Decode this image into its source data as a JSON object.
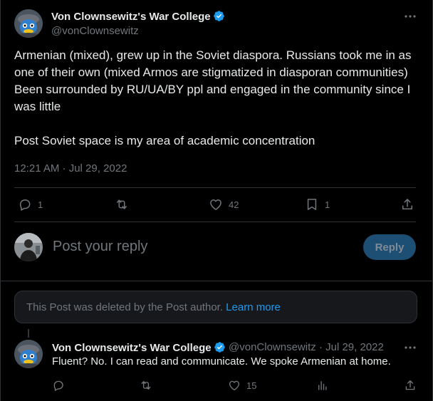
{
  "main_post": {
    "author_name": "Von Clownsewitz's War College",
    "handle": "@vonClownsewitz",
    "paragraph_1": "Armenian (mixed), grew up in the Soviet diaspora. Russians took me in as one of their own (mixed Armos are stigmatized in diasporan communities) Been surrounded by RU/UA/BY ppl and engaged in the community since I was little",
    "paragraph_2": "Post Soviet space is my area of academic concentration",
    "timestamp": "12:21 AM · Jul 29, 2022",
    "stats": {
      "replies": "1",
      "likes": "42",
      "bookmarks": "1"
    }
  },
  "composer": {
    "placeholder": "Post your reply",
    "button_label": "Reply"
  },
  "deleted_notice": {
    "text": "This Post was deleted by the Post author.",
    "link_label": "Learn more"
  },
  "reply_post": {
    "author_name": "Von Clownsewitz's War College",
    "handle": "@vonClownsewitz",
    "date": "· Jul 29, 2022",
    "text": "Fluent? No. I can read and communicate. We spoke Armenian at home.",
    "stats": {
      "likes": "15"
    }
  },
  "icons": {
    "verified": "verified-badge-icon",
    "more": "more-horizontal-icon",
    "reply": "reply-bubble-icon",
    "repost": "repost-icon",
    "like": "heart-icon",
    "bookmark": "bookmark-icon",
    "share": "share-upload-icon",
    "views": "views-bar-chart-icon"
  },
  "colors": {
    "background": "#000000",
    "text": "#e7e9ea",
    "muted": "#71767b",
    "accent": "#1d9bf0",
    "reply_button_disabled": "#1d4e74",
    "border": "#2f3336"
  }
}
